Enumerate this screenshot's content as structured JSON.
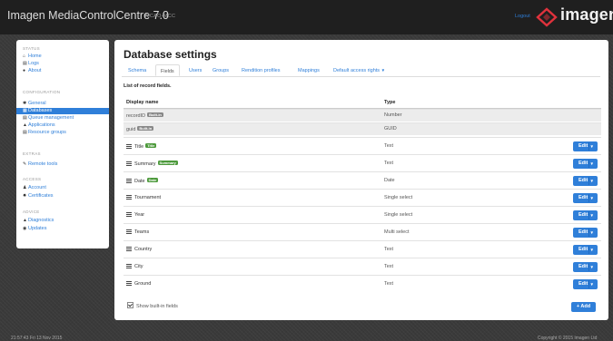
{
  "header": {
    "app_title": "Imagen MediaControlCentre 7.0",
    "instance": "MCAO-MCC",
    "logout": "Logout",
    "brand": "imagen",
    "brand_color": "#e0323c"
  },
  "sidebar": {
    "sections": {
      "status": "STATUS",
      "configuration": "CONFIGURATION",
      "extras": "EXTRAS",
      "access": "ACCESS",
      "advice": "ADVICE"
    },
    "items": {
      "home": {
        "label": "Home",
        "icon": "home-icon"
      },
      "logs": {
        "label": "Logs",
        "icon": "list-icon"
      },
      "about": {
        "label": "About",
        "icon": "info-icon"
      },
      "general": {
        "label": "General",
        "icon": "gear-icon"
      },
      "databases": {
        "label": "Databases",
        "icon": "database-icon",
        "active": true
      },
      "queue": {
        "label": "Queue management",
        "icon": "queue-icon"
      },
      "applications": {
        "label": "Applications",
        "icon": "app-icon"
      },
      "resource_groups": {
        "label": "Resource groups",
        "icon": "group-icon"
      },
      "remote_tools": {
        "label": "Remote tools",
        "icon": "wrench-icon"
      },
      "account": {
        "label": "Account",
        "icon": "user-icon"
      },
      "certificates": {
        "label": "Certificates",
        "icon": "certificate-icon"
      },
      "diagnostics": {
        "label": "Diagnostics",
        "icon": "warning-icon"
      },
      "updates": {
        "label": "Updates",
        "icon": "globe-icon"
      }
    }
  },
  "main": {
    "title": "Database settings",
    "tabs": {
      "schema": "Schema",
      "fields": "Fields",
      "users": "Users",
      "groups": "Groups",
      "rendition": "Rendition profiles",
      "mappings": "Mappings",
      "default_access": "Default access rights"
    },
    "active_tab": "Fields",
    "list_title": "List of record fields.",
    "columns": {
      "display_name": "Display name",
      "type": "Type"
    },
    "rows": [
      {
        "name": "recordID",
        "badge": "Built-in",
        "type": "Number"
      },
      {
        "name": "guid",
        "badge": "Built-in",
        "type": "GUID"
      },
      {
        "name": "Title",
        "badge": "Title",
        "type": "Text",
        "edit": "Edit"
      },
      {
        "name": "Summary",
        "badge": "Summary",
        "type": "Text",
        "edit": "Edit"
      },
      {
        "name": "Date",
        "badge": "Date",
        "type": "Date",
        "edit": "Edit"
      },
      {
        "name": "Tournament",
        "type": "Single select",
        "edit": "Edit"
      },
      {
        "name": "Year",
        "type": "Single select",
        "edit": "Edit"
      },
      {
        "name": "Teams",
        "type": "Multi select",
        "edit": "Edit"
      },
      {
        "name": "Country",
        "type": "Text",
        "edit": "Edit"
      },
      {
        "name": "City",
        "type": "Text",
        "edit": "Edit"
      },
      {
        "name": "Ground",
        "type": "Text",
        "edit": "Edit"
      }
    ],
    "show_builtin_label": "Show built-in fields",
    "show_builtin_checked": true,
    "add_button": "+ Add"
  },
  "footer": {
    "left": "21:57:43 Fri 13 Nov 2015",
    "right": "Copyright © 2015 Imagen Ltd"
  },
  "colors": {
    "accent": "#2f7fd9",
    "badge_builtin": "#888888",
    "badge_title": "#4d9a3c"
  }
}
